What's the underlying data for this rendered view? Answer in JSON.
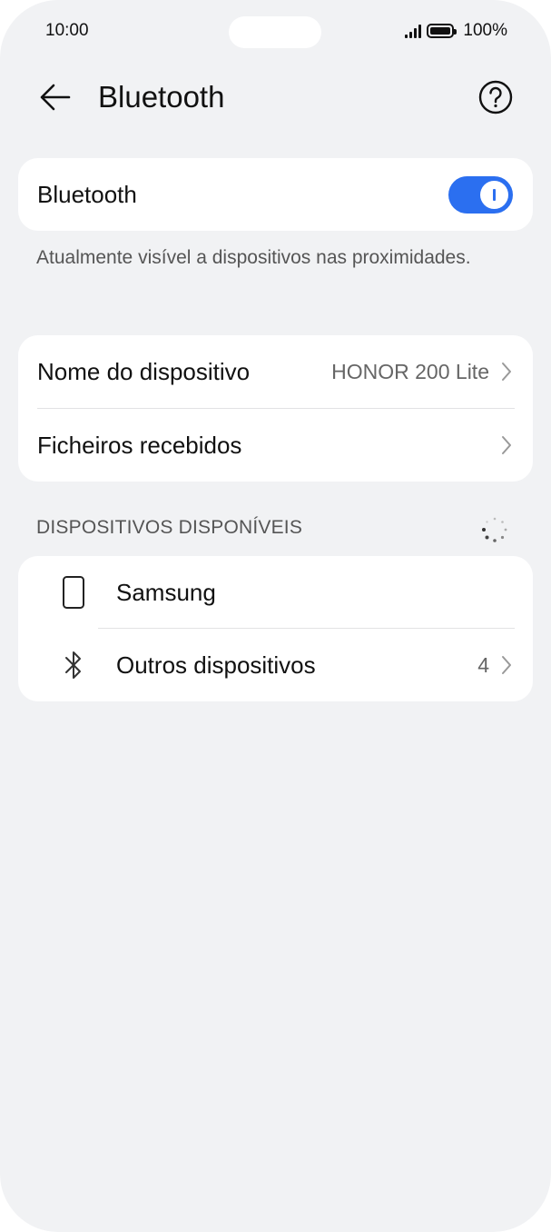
{
  "status_bar": {
    "time": "10:00",
    "battery": "100%"
  },
  "header": {
    "title": "Bluetooth",
    "back_icon": "arrow-left-icon",
    "help_icon": "question-circle-icon"
  },
  "bluetooth_card": {
    "label": "Bluetooth",
    "toggle_on": true,
    "accent_color": "#2b6ff0"
  },
  "visibility_note": "Atualmente visível a dispositivos nas proximidades.",
  "device_card": {
    "name_label": "Nome do dispositivo",
    "name_value": "HONOR 200 Lite",
    "received_label": "Ficheiros recebidos"
  },
  "available_section": {
    "title": "DISPOSITIVOS DISPONÍVEIS",
    "items": [
      {
        "label": "Samsung",
        "icon": "phone-icon",
        "count": ""
      },
      {
        "label": "Outros dispositivos",
        "icon": "bluetooth-icon",
        "count": "4"
      }
    ]
  }
}
